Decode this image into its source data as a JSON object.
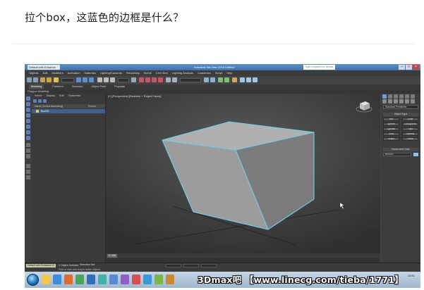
{
  "question": "拉个box，这蓝色的边框是什么？",
  "app": {
    "tab_label": "Default with Enhance",
    "window_title": "Autodesk 3ds Max 2016   Untitled",
    "search_placeholder": "Type a keyword or phrase",
    "menu": [
      "Objects",
      "Edit",
      "Modifiers",
      "Animation",
      "Materials",
      "Lighting/Cameras",
      "Rendering",
      "Scene",
      "Civil View",
      "Lighting Analysis",
      "Customize",
      "Script",
      "Help"
    ],
    "ribbon_tabs": [
      "Modeling",
      "Freeform",
      "Selection",
      "Object Paint",
      "Populate"
    ],
    "subribbon": "Polygon Modeling",
    "explorer_menu": [
      "Select",
      "Display",
      "Edit",
      "Customize"
    ],
    "explorer_columns": [
      "Name (Sorted Ascending)",
      "Frozen"
    ],
    "explorer_row": "Box001",
    "viewport_label": "[+] [Perspective] [Realistic + Edged Faces]",
    "command_panel": {
      "dropdown": "Standard Primitives",
      "object_type": "Object Type",
      "buttons": [
        "Box",
        "Cone",
        "Sphere",
        "GeoSphere",
        "Cylinder",
        "Tube",
        "Torus",
        "Pyramid",
        "Teapot",
        "Plane"
      ],
      "name_color": "Name and Color",
      "name": "Box001",
      "swatch_color": "#8fc3e6"
    },
    "timeslider": "0 / 100",
    "status": {
      "maxscript": "Default with Enhanced M",
      "line1": "1 Object Selected",
      "line2": "Click or click-and-drag to select objects",
      "selection": "Selection Set:"
    },
    "taskbar_time": "20:51"
  },
  "watermark": "3Dmax吧 【www.linecg.com/tieba/1771】",
  "colors": {
    "selection_edge": "#6ed0f0",
    "box_front": "#9c9c9c",
    "box_top": "#b5b5b5",
    "box_side": "#7a7a7a"
  }
}
